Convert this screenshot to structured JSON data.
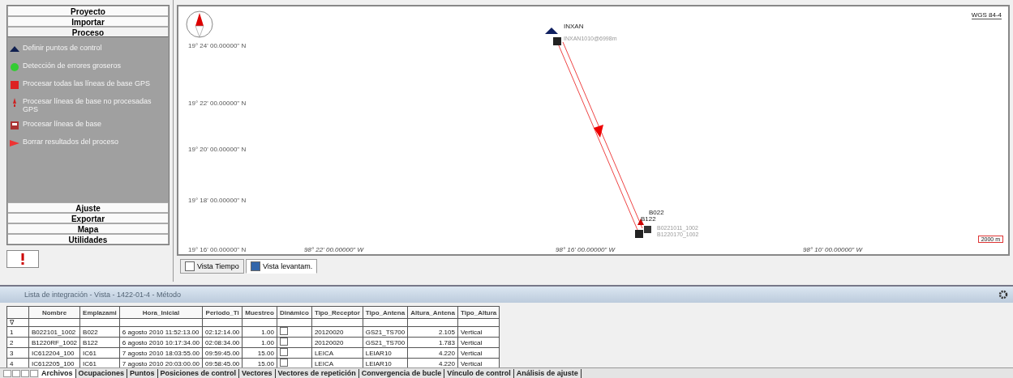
{
  "sidebar": {
    "sections": [
      {
        "label": "Proyecto",
        "expanded": false
      },
      {
        "label": "Importar",
        "expanded": false
      },
      {
        "label": "Proceso",
        "expanded": true,
        "items": [
          {
            "label": "Definir puntos de control"
          },
          {
            "label": "Detección de errores groseros"
          },
          {
            "label": "Procesar todas las líneas de base GPS"
          },
          {
            "label": "Procesar líneas de base no procesadas GPS"
          },
          {
            "label": "Procesar líneas de base"
          },
          {
            "label": "Borrar resultados del proceso"
          }
        ]
      },
      {
        "label": "Ajuste",
        "expanded": false
      },
      {
        "label": "Exportar",
        "expanded": false
      },
      {
        "label": "Mapa",
        "expanded": false
      },
      {
        "label": "Utilidades",
        "expanded": false
      }
    ]
  },
  "map": {
    "datum": "WGS 84-4",
    "scale": "2000 m",
    "lat_labels": [
      "19° 24' 00.00000\" N",
      "19° 22' 00.00000\" N",
      "19° 20' 00.00000\" N",
      "19° 18' 00.00000\" N",
      "19° 16' 00.00000\" N"
    ],
    "lon_labels": [
      "98° 22' 00.00000\" W",
      "98° 16' 00.00000\" W",
      "98° 10' 00.00000\" W"
    ],
    "points": [
      {
        "name": "INXAN",
        "detail": "INXAN1010@6998m"
      },
      {
        "name": "B022",
        "detail": "B0221011_1002"
      },
      {
        "name": "B122",
        "detail": "B1220170_1002"
      }
    ]
  },
  "view_tabs": [
    {
      "label": "Vista Tiempo",
      "selected": false
    },
    {
      "label": "Vista levantam.",
      "selected": true
    }
  ],
  "panel": {
    "title": "Lista de integración - Vista - 1422-01-4 - Método"
  },
  "table": {
    "columns": [
      "Nombre",
      "Emplazami",
      "Hora_Inicial",
      "Periodo_Ti",
      "Muestreo",
      "Dinámico",
      "Tipo_Receptor",
      "Tipo_Antena",
      "Altura_Antena",
      "Tipo_Altura"
    ],
    "filter_mark": "∇",
    "rows": [
      {
        "index": "1",
        "cells": [
          "B022101_1002",
          "B022",
          "6 agosto 2010 11:52:13.00",
          "02:12:14.00",
          "1.00",
          "",
          "20120020",
          "GS21_TS700",
          "2.105",
          "Vertical"
        ],
        "dynamic": false
      },
      {
        "index": "2",
        "cells": [
          "B1220RF_1002",
          "B122",
          "6 agosto 2010 10:17:34.00",
          "02:08:34.00",
          "1.00",
          "",
          "20120020",
          "GS21_TS700",
          "1.783",
          "Vertical"
        ],
        "dynamic": false
      },
      {
        "index": "3",
        "cells": [
          "IC612204_100",
          "IC61",
          "7 agosto 2010 18:03:55.00",
          "09:59:45.00",
          "15.00",
          "",
          "LEICA",
          "LEIAR10",
          "4.220",
          "Vertical"
        ],
        "dynamic": false
      },
      {
        "index": "4",
        "cells": [
          "IC612205_100",
          "IC61",
          "7 agosto 2010 20:03:00.00",
          "09:58:45.00",
          "15.00",
          "",
          "LEICA",
          "LEIAR10",
          "4.220",
          "Vertical"
        ],
        "dynamic": false
      }
    ]
  },
  "sheet_tabs": [
    {
      "label": "Archivos",
      "selected": true
    },
    {
      "label": "Ocupaciones",
      "selected": false
    },
    {
      "label": "Puntos",
      "selected": false
    },
    {
      "label": "Posiciones de control",
      "selected": false
    },
    {
      "label": "Vectores",
      "selected": false
    },
    {
      "label": "Vectores de repetición",
      "selected": false
    },
    {
      "label": "Convergencia de bucle",
      "selected": false
    },
    {
      "label": "Vínculo de control",
      "selected": false
    },
    {
      "label": "Análisis de ajuste",
      "selected": false
    }
  ]
}
